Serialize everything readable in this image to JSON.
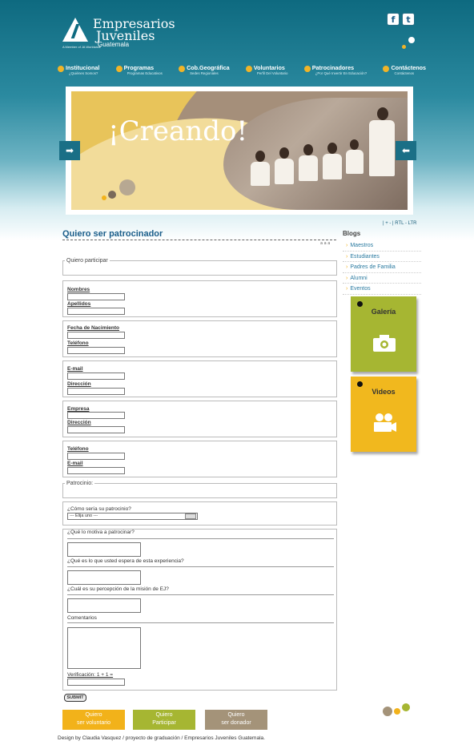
{
  "header": {
    "logo_line1": "Empresarios",
    "logo_line2": "Juveniles",
    "logo_line3": "Guatemala",
    "logo_sub": "A Member of JA Worldwide",
    "social": {
      "facebook": "f",
      "twitter": "t"
    }
  },
  "nav": [
    {
      "label": "Institucional",
      "sub": "¿Quiénes Somos?"
    },
    {
      "label": "Programas",
      "sub": "Programas Educativos"
    },
    {
      "label": "Cob.Geográfica",
      "sub": "Sedes Regionales"
    },
    {
      "label": "Voluntarios",
      "sub": "Perfil Del Voluntario"
    },
    {
      "label": "Patrocinadores",
      "sub": "¿Por Qué Invertir En Educación?"
    },
    {
      "label": "Contáctenos",
      "sub": "Contáctenos"
    }
  ],
  "banner": {
    "title": "¡Creando!"
  },
  "utility": {
    "text": "| + - | RTL - LTR"
  },
  "page": {
    "title": "Quiero ser patrocinador",
    "text_size": "a a a"
  },
  "form": {
    "legend_participar": "Quiero participar",
    "nombres": "Nombres",
    "apellidos": "Apellidos",
    "fecha_nacimiento": "Fecha de Nacimiento",
    "telefono1": "Teléfono",
    "email1": "E-mail",
    "direccion1": "Dirección",
    "empresa": "Empresa",
    "direccion2": "Dirección",
    "telefono2": "Teléfono",
    "email2": "E-mail",
    "legend_patrocinio": "Patrocinio:",
    "como_label": "¿Cómo sería su patrocinio?",
    "select_value": "--- Elija uno ---",
    "q_motiva": "¿Qué lo motiva a patrocinar?",
    "q_espera": "¿Qué es lo que usted espera de esta experiencia?",
    "q_percepcion": "¿Cuál es su percepción de la misión de EJ?",
    "comentarios": "Comentarios",
    "verificacion": "Verificación: 1 + 1 =",
    "submit": "SUBMIT"
  },
  "sidebar": {
    "blogs_title": "Blogs",
    "blogs": [
      "Maestros",
      "Estudiantes",
      "Padres de Familia",
      "Alumni",
      "Eventos"
    ],
    "galeria": "Galería",
    "videos": "Videos"
  },
  "bottom_buttons": [
    {
      "line1": "Quiero",
      "line2": "ser voluntario"
    },
    {
      "line1": "Quiero",
      "line2": "Participar"
    },
    {
      "line1": "Quiero",
      "line2": "ser donador"
    }
  ],
  "footer": "Design by Claudia Vasquez / proyecto de graduación / Empresarios Juveniles Guatemala.",
  "colors": {
    "teal": "#0e6a80",
    "yellow": "#f2b21a",
    "green": "#a6b632",
    "taupe": "#a49379",
    "link_blue": "#1b5e8a"
  }
}
